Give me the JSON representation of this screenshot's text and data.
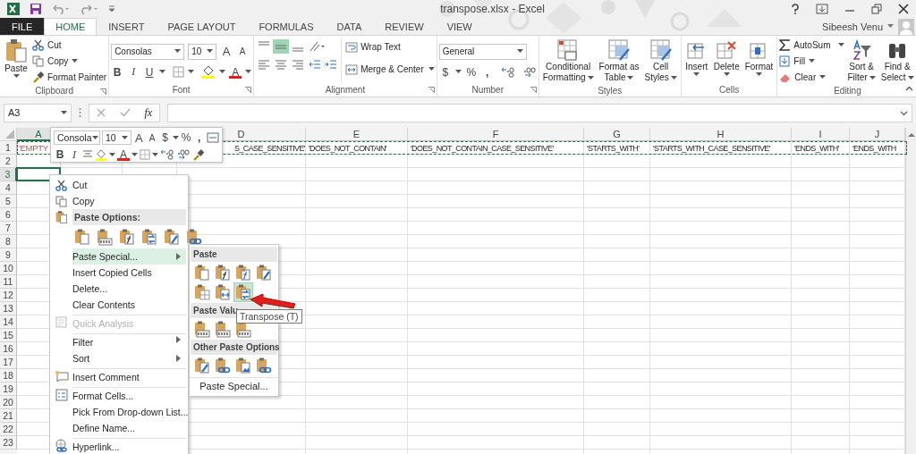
{
  "window": {
    "title": "transpose.xlsx - Excel",
    "user": "Sibeesh Venu"
  },
  "ribbon_tabs": [
    {
      "label": "FILE",
      "kind": "backstage",
      "selected": false
    },
    {
      "label": "HOME",
      "kind": "tab",
      "selected": true
    },
    {
      "label": "INSERT",
      "kind": "tab",
      "selected": false
    },
    {
      "label": "PAGE LAYOUT",
      "kind": "tab",
      "selected": false
    },
    {
      "label": "FORMULAS",
      "kind": "tab",
      "selected": false
    },
    {
      "label": "DATA",
      "kind": "tab",
      "selected": false
    },
    {
      "label": "REVIEW",
      "kind": "tab",
      "selected": false
    },
    {
      "label": "VIEW",
      "kind": "tab",
      "selected": false
    }
  ],
  "clipboard": {
    "label": "Clipboard",
    "paste": "Paste",
    "cut": "Cut",
    "copy": "Copy",
    "format_painter": "Format Painter"
  },
  "font": {
    "label": "Font",
    "name": "Consolas",
    "size": "10",
    "grow": "A",
    "shrink": "A",
    "bold": "B",
    "italic": "I",
    "underline": "U",
    "font_color": "A"
  },
  "alignment": {
    "label": "Alignment",
    "vertical": [
      {
        "selected": false
      },
      {
        "selected": true
      },
      {
        "selected": false
      }
    ],
    "wrap_text": "Wrap Text",
    "merge": "Merge & Center"
  },
  "number": {
    "label": "Number",
    "format": "General",
    "currency": "$",
    "percent": "%",
    "comma": ","
  },
  "styles": {
    "label": "Styles",
    "buttons": [
      [
        "Conditional",
        "Formatting"
      ],
      [
        "Format as",
        "Table"
      ],
      [
        "Cell",
        "Styles"
      ]
    ]
  },
  "cells": {
    "label": "Cells",
    "buttons": [
      "Insert",
      "Delete",
      "Format"
    ]
  },
  "editing": {
    "label": "Editing",
    "autosum": "AutoSum",
    "fill": "Fill",
    "clear": "Clear",
    "sort": [
      "Sort &",
      "Filter"
    ],
    "find": [
      "Find &",
      "Select"
    ]
  },
  "formula_bar": {
    "name_box": "A3",
    "function": "fx"
  },
  "columns": [
    {
      "label": "A",
      "selected": true,
      "row_1": {
        "text": "'EMPTY",
        "color": "#c0504d"
      }
    },
    {
      "label": "D",
      "selected": false,
      "row_1": {
        "text": "S_CASE_SENSITIVE'"
      }
    },
    {
      "label": "E",
      "selected": false,
      "row_1": {
        "text": "'DOES_NOT_CONTAIN'"
      }
    },
    {
      "label": "F",
      "selected": false,
      "row_1": {
        "text": "'DOES_NOT_CONTAIN_CASE_SENSITIVE'"
      }
    },
    {
      "label": "G",
      "selected": false,
      "row_1": {
        "text": "'STARTS_WITH'"
      }
    },
    {
      "label": "H",
      "selected": false,
      "row_1": {
        "text": "'STARTS_WITH_CASE_SENSITIVE'"
      }
    },
    {
      "label": "I",
      "selected": false,
      "row_1": {
        "text": "'ENDS_WITH'"
      }
    },
    {
      "label": "J",
      "selected": false,
      "row_1": {
        "text": "'ENDS_WITH"
      }
    }
  ],
  "rows": [
    {
      "label": "1",
      "selected": false
    },
    {
      "label": "2",
      "selected": false
    },
    {
      "label": "3",
      "selected": true
    },
    {
      "label": "4",
      "selected": false
    },
    {
      "label": "5",
      "selected": false
    },
    {
      "label": "6",
      "selected": false
    },
    {
      "label": "7",
      "selected": false
    },
    {
      "label": "8",
      "selected": false
    },
    {
      "label": "9",
      "selected": false
    },
    {
      "label": "10",
      "selected": false
    },
    {
      "label": "11",
      "selected": false
    },
    {
      "label": "12",
      "selected": false
    },
    {
      "label": "13",
      "selected": false
    },
    {
      "label": "14",
      "selected": false
    },
    {
      "label": "15",
      "selected": false
    },
    {
      "label": "16",
      "selected": false
    },
    {
      "label": "17",
      "selected": false
    },
    {
      "label": "18",
      "selected": false
    },
    {
      "label": "19",
      "selected": false
    },
    {
      "label": "20",
      "selected": false
    },
    {
      "label": "21",
      "selected": false
    },
    {
      "label": "22",
      "selected": false
    },
    {
      "label": "23",
      "selected": false
    }
  ],
  "mini_toolbar": {
    "font": "Consola",
    "size": "10",
    "grow": "A",
    "shrink": "A",
    "currency": "$",
    "percent": "%",
    "comma": ",",
    "bold": "B",
    "italic": "I",
    "font_color": "A"
  },
  "context_menu": [
    {
      "kind": "command",
      "label": "Cut",
      "separator_before": false,
      "highlighted": false,
      "disabled": false,
      "submenu": false
    },
    {
      "kind": "command",
      "label": "Copy",
      "separator_before": false,
      "highlighted": false,
      "disabled": false,
      "submenu": false
    },
    {
      "kind": "header",
      "label": "Paste Options:"
    },
    {
      "kind": "icons",
      "icons": [
        {
          "selected": false
        },
        {
          "selected": false
        },
        {
          "selected": false
        },
        {
          "selected": false
        },
        {
          "selected": false
        },
        {
          "selected": false
        }
      ]
    },
    {
      "kind": "command",
      "label": "Paste Special...",
      "separator_before": false,
      "highlighted": true,
      "disabled": false,
      "submenu": true
    },
    {
      "kind": "command",
      "label": "Insert Copied Cells",
      "separator_before": false,
      "highlighted": false,
      "disabled": false,
      "submenu": false
    },
    {
      "kind": "command",
      "label": "Delete...",
      "separator_before": false,
      "highlighted": false,
      "disabled": false,
      "submenu": false
    },
    {
      "kind": "command",
      "label": "Clear Contents",
      "separator_before": false,
      "highlighted": false,
      "disabled": false,
      "submenu": false
    },
    {
      "kind": "command",
      "label": "Quick Analysis",
      "separator_before": true,
      "highlighted": false,
      "disabled": true,
      "submenu": false
    },
    {
      "kind": "command",
      "label": "Filter",
      "separator_before": true,
      "highlighted": false,
      "disabled": false,
      "submenu": true
    },
    {
      "kind": "command",
      "label": "Sort",
      "separator_before": false,
      "highlighted": false,
      "disabled": false,
      "submenu": true
    },
    {
      "kind": "command",
      "label": "Insert Comment",
      "separator_before": true,
      "highlighted": false,
      "disabled": false,
      "submenu": false
    },
    {
      "kind": "command",
      "label": "Format Cells...",
      "separator_before": true,
      "highlighted": false,
      "disabled": false,
      "submenu": false
    },
    {
      "kind": "command",
      "label": "Pick From Drop-down List...",
      "separator_before": false,
      "highlighted": false,
      "disabled": false,
      "submenu": false
    },
    {
      "kind": "command",
      "label": "Define Name...",
      "separator_before": false,
      "highlighted": false,
      "disabled": false,
      "submenu": false
    },
    {
      "kind": "command",
      "label": "Hyperlink...",
      "separator_before": true,
      "highlighted": false,
      "disabled": false,
      "submenu": false
    }
  ],
  "paste_submenu": {
    "sections": [
      {
        "title": "Paste",
        "icons": [
          {
            "selected": false
          },
          {
            "selected": false
          },
          {
            "selected": false
          },
          {
            "selected": false
          },
          {
            "selected": false
          },
          {
            "selected": false
          },
          {
            "selected": true
          }
        ]
      },
      {
        "title": "Paste Valu",
        "icons": [
          {
            "selected": false
          },
          {
            "selected": false
          },
          {
            "selected": false
          }
        ]
      },
      {
        "title": "Other Paste Options",
        "icons": [
          {
            "selected": false
          },
          {
            "selected": false
          },
          {
            "selected": false
          },
          {
            "selected": false
          }
        ]
      }
    ],
    "footer": "Paste Special..."
  },
  "tooltip": "Transpose (T)"
}
